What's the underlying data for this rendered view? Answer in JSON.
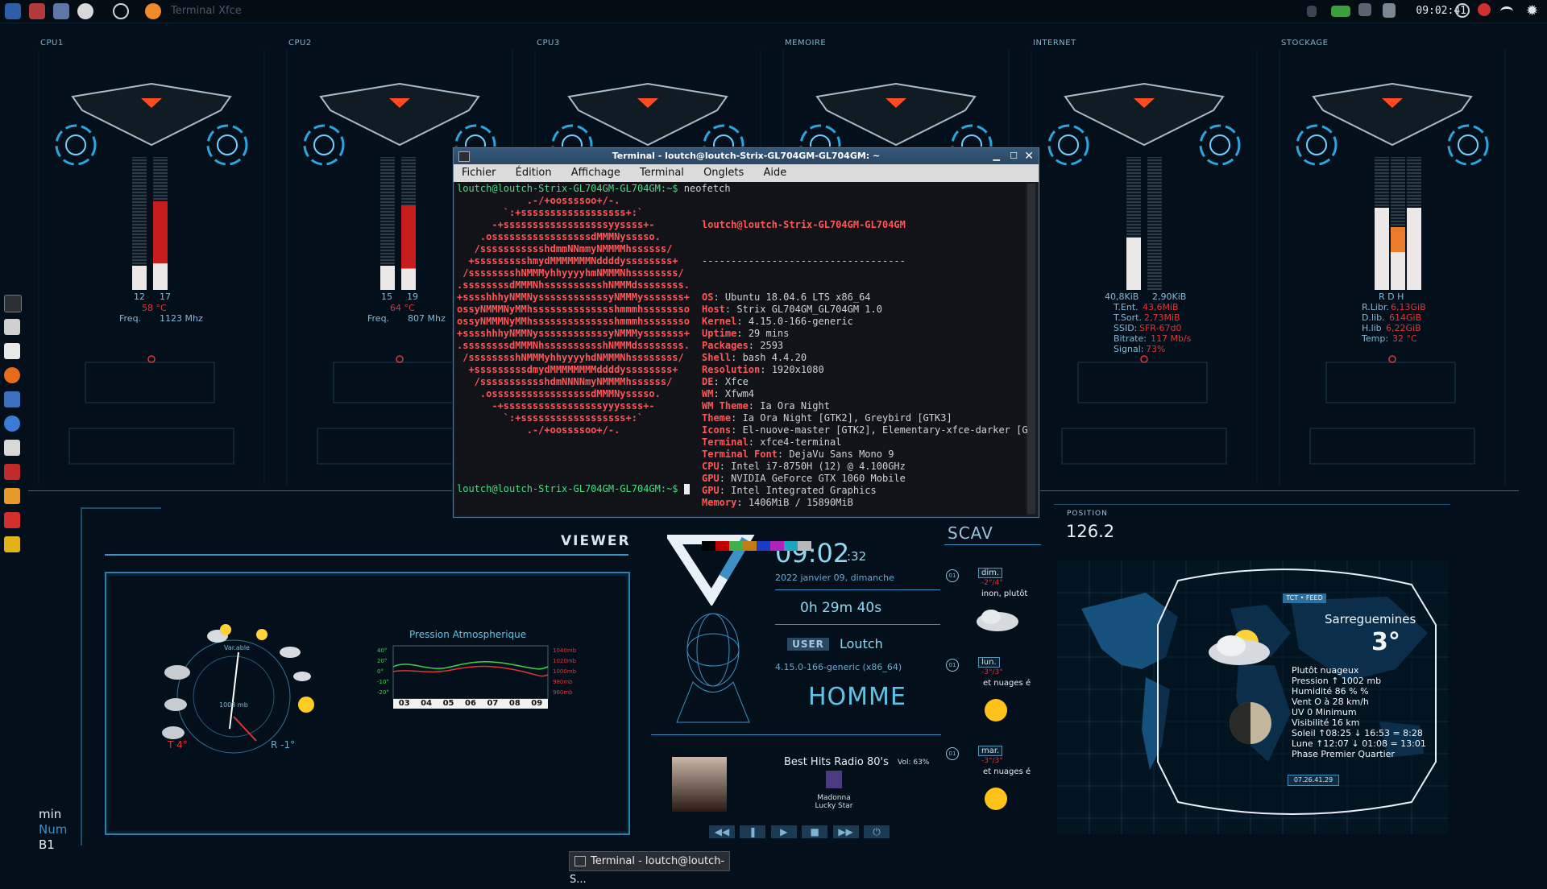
{
  "panel": {
    "task_label": "Terminal Xfce",
    "clock": "09:02:41",
    "colors": {
      "panel_bg": "#040c14"
    }
  },
  "hud": {
    "column_labels": [
      "CPU1",
      "CPU2",
      "CPU3",
      "MEMOIRE",
      "INTERNET",
      "STOCKAGE"
    ],
    "cpu1": {
      "v1": "12",
      "v2": "17",
      "temp": "58 °C",
      "freq_label": "Freq.",
      "freq_value": "1123 Mhz"
    },
    "cpu2": {
      "v1": "15",
      "v2": "19",
      "temp": "64 °C",
      "freq_label": "Freq.",
      "freq_value": "807 Mhz"
    },
    "internet": {
      "down": "40,8KiB",
      "up": "2,90KiB",
      "t_ent_label": "T.Ent.",
      "t_ent": "43,6MiB",
      "t_sort_label": "T.Sort.",
      "t_sort": "2,73MiB",
      "ssid_label": "SSID:",
      "ssid": "SFR-67d0",
      "bitrate_label": "Bitrate:",
      "bitrate": "117 Mb/s",
      "signal_label": "Signal:",
      "signal": "73%"
    },
    "stockage": {
      "labels": "R  D  H",
      "r_libr_label": "R.Libr.",
      "r_libr": "6,13GiB",
      "d_lib_label": "D.lib.",
      "d_lib": "614GiB",
      "h_lib_label": "H.lib",
      "h_lib": "6,22GiB",
      "temp_label": "Temp:",
      "temp": "32 °C"
    }
  },
  "terminal": {
    "title": "Terminal - loutch@loutch-Strix-GL704GM-GL704GM: ~",
    "menu": [
      "Fichier",
      "Édition",
      "Affichage",
      "Terminal",
      "Onglets",
      "Aide"
    ],
    "prompt": "loutch@loutch-Strix-GL704GM-GL704GM:~$",
    "command": "neofetch",
    "host_header": "loutch@loutch-Strix-GL704GM-GL704GM",
    "separator": "-----------------------------------",
    "info": [
      {
        "k": "OS",
        "v": "Ubuntu 18.04.6 LTS x86_64"
      },
      {
        "k": "Host",
        "v": "Strix GL704GM_GL704GM 1.0"
      },
      {
        "k": "Kernel",
        "v": "4.15.0-166-generic"
      },
      {
        "k": "Uptime",
        "v": "29 mins"
      },
      {
        "k": "Packages",
        "v": "2593"
      },
      {
        "k": "Shell",
        "v": "bash 4.4.20"
      },
      {
        "k": "Resolution",
        "v": "1920x1080"
      },
      {
        "k": "DE",
        "v": "Xfce"
      },
      {
        "k": "WM",
        "v": "Xfwm4"
      },
      {
        "k": "WM Theme",
        "v": "Ia Ora Night"
      },
      {
        "k": "Theme",
        "v": "Ia Ora Night [GTK2], Greybird [GTK3]"
      },
      {
        "k": "Icons",
        "v": "El-nuove-master [GTK2], Elementary-xfce-darker [G"
      },
      {
        "k": "Terminal",
        "v": "xfce4-terminal"
      },
      {
        "k": "Terminal Font",
        "v": "DejaVu Sans Mono 9"
      },
      {
        "k": "CPU",
        "v": "Intel i7-8750H (12) @ 4.100GHz"
      },
      {
        "k": "GPU",
        "v": "NVIDIA GeForce GTX 1060 Mobile"
      },
      {
        "k": "GPU",
        "v": "Intel Integrated Graphics"
      },
      {
        "k": "Memory",
        "v": "1406MiB / 15890MiB"
      }
    ],
    "palette": [
      "#000000",
      "#c00000",
      "#3fb04a",
      "#c27a12",
      "#1a3cc4",
      "#b022b8",
      "#1aa6c0",
      "#b8b8b8"
    ],
    "ascii": [
      "            .-/+oossssoo+/-.",
      "        `:+ssssssssssssssssss+:`",
      "      -+ssssssssssssssssssyyssss+-",
      "    .osssssssssssssssssdMMMNysssso.",
      "   /ssssssssssshdmmNNmmyNMMMMhssssss/",
      "  +ssssssssshmydMMMMMMMNddddyssssssss+",
      " /sssssssshNMMMyhhyyyyhmNMMMNhssssssss/",
      ".ssssssssdMMMNhsssssssssshNMMMdssssssss.",
      "+sssshhhyNMMNyssssssssssssyNMMMysssssss+",
      "ossyNMMMNyMMhsssssssssssssshmmmhssssssso",
      "ossyNMMMNyMMhsssssssssssssshmmmhssssssso",
      "+sssshhhyNMMNyssssssssssssyNMMMysssssss+",
      ".ssssssssdMMMNhsssssssssshNMMMdssssssss.",
      " /sssssssshNMMMyhhyyyyhdNMMMNhssssssss/",
      "  +sssssssssdmydMMMMMMMMddddyssssssss+",
      "   /ssssssssssshdmNNNNmyNMMMMhssssss/",
      "    .osssssssssssssssssdMMMNysssso.",
      "      -+sssssssssssssssssyyyssss+-",
      "        `:+ssssssssssssssssss+:`",
      "            .-/+oossssoo+/-."
    ]
  },
  "viewer": {
    "title": "VIEWER",
    "pressure_title": "Pression Atmospherique",
    "gauge_center": "1003 mb",
    "gauge_var": "Var.able",
    "t_label": "T 4°",
    "r_label": "R -1°",
    "y_ticks": [
      "40°",
      "20°",
      "0°",
      "-10°",
      "-20°"
    ],
    "p_ticks": [
      "1040mb",
      "1020mb",
      "1000mb",
      "980mb",
      "960mb"
    ],
    "days": [
      "03",
      "04",
      "05",
      "06",
      "07",
      "08",
      "09"
    ]
  },
  "system": {
    "time": "09:02",
    "seconds": ":32",
    "date": "2022 janvier 09, dimanche",
    "uptime": "0h 29m 40s",
    "user_label": "USER",
    "user": "Loutch",
    "kernel": "4.15.0-166-generic (x86_64)",
    "gender": "HOMME"
  },
  "radio": {
    "station": "Best Hits Radio 80's",
    "volume": "Vol: 63%",
    "artist": "Madonna",
    "track": "Lucky Star"
  },
  "forecast": {
    "title": "SCAV",
    "days": [
      {
        "day": "dim.",
        "temp": "-2°/4°",
        "desc": "inon, plutôt"
      },
      {
        "day": "lun.",
        "temp": "-3°/3°",
        "desc": "et nuages é"
      },
      {
        "day": "mar.",
        "temp": "-3°/3°",
        "desc": "et nuages é"
      }
    ],
    "markers": [
      "01",
      "01",
      "01"
    ]
  },
  "position": {
    "label": "POSITION",
    "value": "126.2"
  },
  "weather": {
    "badge": "TCT • FEED",
    "city": "Sarreguemines",
    "temp": "3°",
    "lines": [
      "Plutôt nuageux",
      "Pression ↑ 1002 mb",
      "Humidité 86 % %",
      "Vent O à 28 km/h",
      "UV 0 Minimum",
      "Visibilité 16 km",
      "Soleil ↑08:25 ↓ 16:53 = 8:28",
      "Lune  ↑12:07 ↓ 01:08 = 13:01",
      "Phase Premier Quartier"
    ],
    "timestamp": "07.26.41.29"
  },
  "status": {
    "lines": [
      "min",
      "Num",
      "B1"
    ]
  },
  "taskbar": {
    "label": "Terminal - loutch@loutch-S..."
  }
}
